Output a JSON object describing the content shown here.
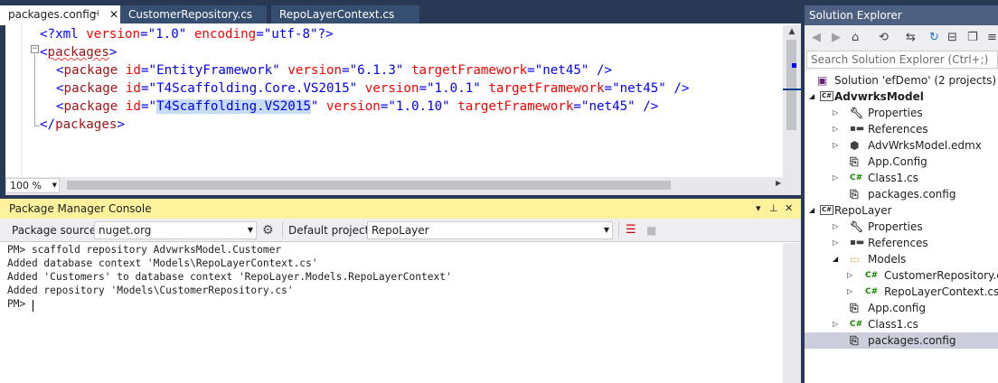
{
  "editor": {
    "tabs": [
      {
        "label": "packages.config"
      },
      {
        "label": "CustomerRepository.cs"
      },
      {
        "label": "RepoLayerContext.cs"
      }
    ],
    "zoom": "100 %",
    "code": {
      "l1": {
        "a": "<?xml ",
        "b": "version",
        "c": "=",
        "d": "\"1.0\"",
        "e": " ",
        "f": "encoding",
        "g": "=",
        "h": "\"utf-8\"",
        "i": "?>"
      },
      "l2": {
        "a": "<",
        "b": "packages",
        "c": ">"
      },
      "l3": {
        "a": "<",
        "b": "package",
        "c": " ",
        "d": "id",
        "e": "=",
        "f": "\"EntityFramework\"",
        "g": " ",
        "h": "version",
        "i": "=",
        "j": "\"6.1.3\"",
        "k": " ",
        "l": "targetFramework",
        "m": "=",
        "n": "\"net45\"",
        "o": " />"
      },
      "l4": {
        "a": "<",
        "b": "package",
        "c": " ",
        "d": "id",
        "e": "=",
        "f": "\"T4Scaffolding.Core.VS2015\"",
        "g": " ",
        "h": "version",
        "i": "=",
        "j": "\"1.0.1\"",
        "k": " ",
        "l": "targetFramework",
        "m": "=",
        "n": "\"net45\"",
        "o": " />"
      },
      "l5": {
        "a": "<",
        "b": "package",
        "c": " ",
        "d": "id",
        "e": "=",
        "f1": "\"",
        "f2": "T4Scaffolding.VS2015",
        "f3": "\"",
        "g": " ",
        "h": "version",
        "i": "=",
        "j": "\"1.0.10\"",
        "k": " ",
        "l": "targetFramework",
        "m": "=",
        "n": "\"net45\"",
        "o": " />"
      },
      "l6": {
        "a": "</",
        "b": "packages",
        "c": ">"
      }
    }
  },
  "pmc": {
    "title": "Package Manager Console",
    "source_label": "Package source:",
    "source_value": "nuget.org",
    "project_label": "Default project:",
    "project_value": "RepoLayer",
    "lines": [
      "PM> scaffold repository AdvwrksModel.Customer",
      "Added database context 'Models\\RepoLayerContext.cs'",
      "Added 'Customers' to database context 'RepoLayer.Models.RepoLayerContext'",
      "Added repository 'Models\\CustomerRepository.cs'",
      "PM> "
    ]
  },
  "solution_explorer": {
    "title": "Solution Explorer",
    "search_placeholder": "Search Solution Explorer (Ctrl+;)",
    "nodes": [
      "Solution 'efDemo' (2 projects)",
      "AdvwrksModel",
      "Properties",
      "References",
      "AdvWrksModel.edmx",
      "App.Config",
      "Class1.cs",
      "packages.config",
      "RepoLayer",
      "Properties",
      "References",
      "Models",
      "CustomerRepository.cs",
      "RepoLayerContext.cs",
      "App.config",
      "Class1.cs",
      "packages.config"
    ],
    "project_icon_text": "C#",
    "cs_icon_text": "C#"
  },
  "colors": {
    "chrome": "#293955",
    "pmc_title_bg": "#fff29d",
    "selection": "#cccedb",
    "xml_blue": "#0000ff",
    "xml_red": "#ff0000",
    "xml_brown": "#a31515"
  },
  "icons": [
    "pin-icon",
    "close-icon",
    "back-icon",
    "forward-icon",
    "home-icon",
    "history-icon",
    "sync-icon",
    "refresh-icon",
    "collapse-icon",
    "copy-icon",
    "properties-icon",
    "settings-icon",
    "clear-icon",
    "stop-icon",
    "dropdown-icon",
    "maximize-icon"
  ]
}
